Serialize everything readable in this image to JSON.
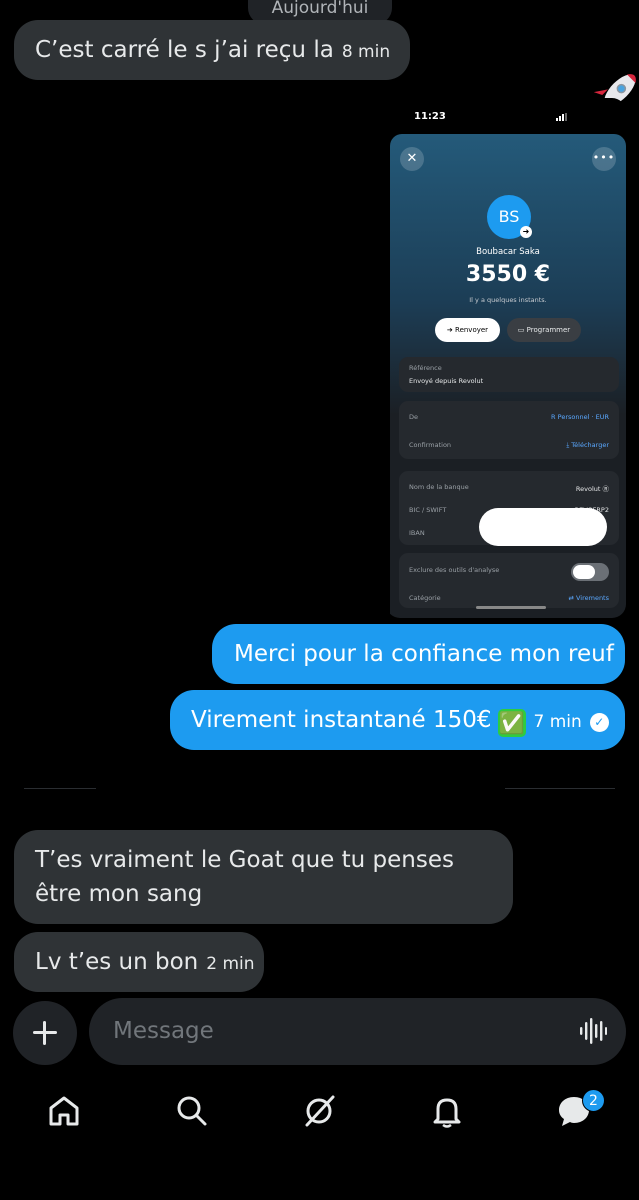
{
  "thread": {
    "date_separator": "Aujourd'hui",
    "messages": [
      {
        "text": "C’est carré le s j’ai reçu la",
        "time": "8 min"
      },
      {
        "text": "Merci pour la confiance mon reuf"
      },
      {
        "text": "Virement instantané 150€",
        "emoji": "✅",
        "time": "7 min"
      },
      {
        "text": "T’es vraiment le Goat que tu penses être mon sang"
      },
      {
        "text": "Lv t’es un bon",
        "time": "2 min"
      }
    ],
    "read_check": "✓",
    "rocket_emoji": "rocket"
  },
  "screenshot": {
    "status_time": "11:23",
    "close_glyph": "✕",
    "more_glyph": "•••",
    "avatar_initials": "BS",
    "recipient_name": "Boubacar Saka",
    "amount": "3550 €",
    "when": "Il y a quelques instants.",
    "btn_resend": "Renvoyer",
    "btn_schedule": "Programmer",
    "reference_label": "Référence",
    "reference_value": "Envoyé depuis Revolut",
    "from_label": "De",
    "from_value": "Personnel · EUR",
    "confirmation_label": "Confirmation",
    "confirmation_action": "Télécharger",
    "bank_label": "Nom de la banque",
    "bank_value": "Revolut",
    "bic_label": "BIC / SWIFT",
    "bic_value": "REVOFRP2",
    "iban_label": "IBAN",
    "analytics_label": "Exclure des outils d'analyse",
    "category_label": "Catégorie",
    "category_value": "Virements"
  },
  "composer": {
    "placeholder": "Message"
  },
  "nav": {
    "messages_badge": "2"
  },
  "colors": {
    "accent": "#1d9bf0",
    "incoming_bubble": "#2f3336",
    "background": "#000000"
  }
}
